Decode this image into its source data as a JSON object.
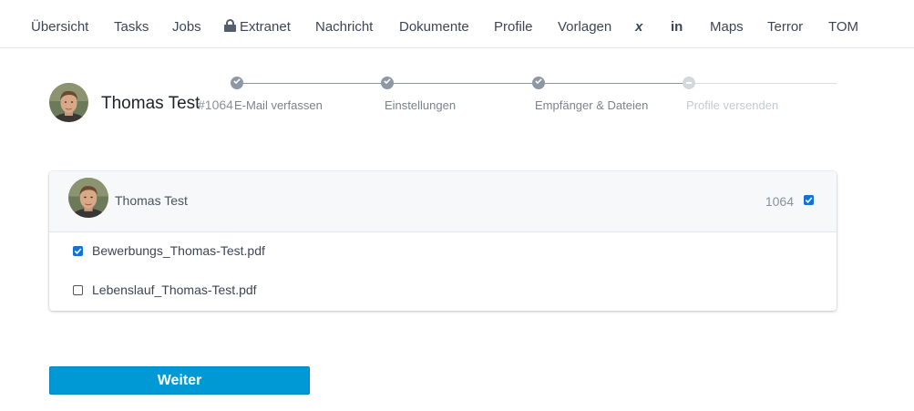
{
  "nav": {
    "items": [
      {
        "label": "Übersicht"
      },
      {
        "label": "Tasks"
      },
      {
        "label": "Jobs"
      },
      {
        "label": "Extranet",
        "icon": "lock-icon"
      },
      {
        "label": "Nachricht"
      },
      {
        "label": "Dokumente"
      },
      {
        "label": "Profile"
      },
      {
        "label": "Vorlagen"
      },
      {
        "label": "",
        "icon": "xing-icon"
      },
      {
        "label": "",
        "icon": "linkedin-icon"
      },
      {
        "label": "Maps"
      },
      {
        "label": "Terror"
      },
      {
        "label": "TOM"
      }
    ],
    "xing_glyph": "x",
    "linkedin_glyph": "in"
  },
  "header": {
    "name": "Thomas Test",
    "id": "#1064"
  },
  "stepper": {
    "steps": [
      {
        "label": "E-Mail verfassen",
        "state": "done"
      },
      {
        "label": "Einstellungen",
        "state": "done"
      },
      {
        "label": "Empfänger & Dateien",
        "state": "done"
      },
      {
        "label": "Profile versenden",
        "state": "pending"
      }
    ]
  },
  "card": {
    "name": "Thomas Test",
    "id": "1064",
    "selected": true,
    "files": [
      {
        "name": "Bewerbungs_Thomas-Test.pdf",
        "checked": true
      },
      {
        "name": "Lebenslauf_Thomas-Test.pdf",
        "checked": false
      }
    ]
  },
  "actions": {
    "next_label": "Weiter"
  },
  "colors": {
    "accent": "#0099d6",
    "checkbox": "#1273d4",
    "step_done": "#8e97a4",
    "step_pending": "#d3d8de"
  }
}
